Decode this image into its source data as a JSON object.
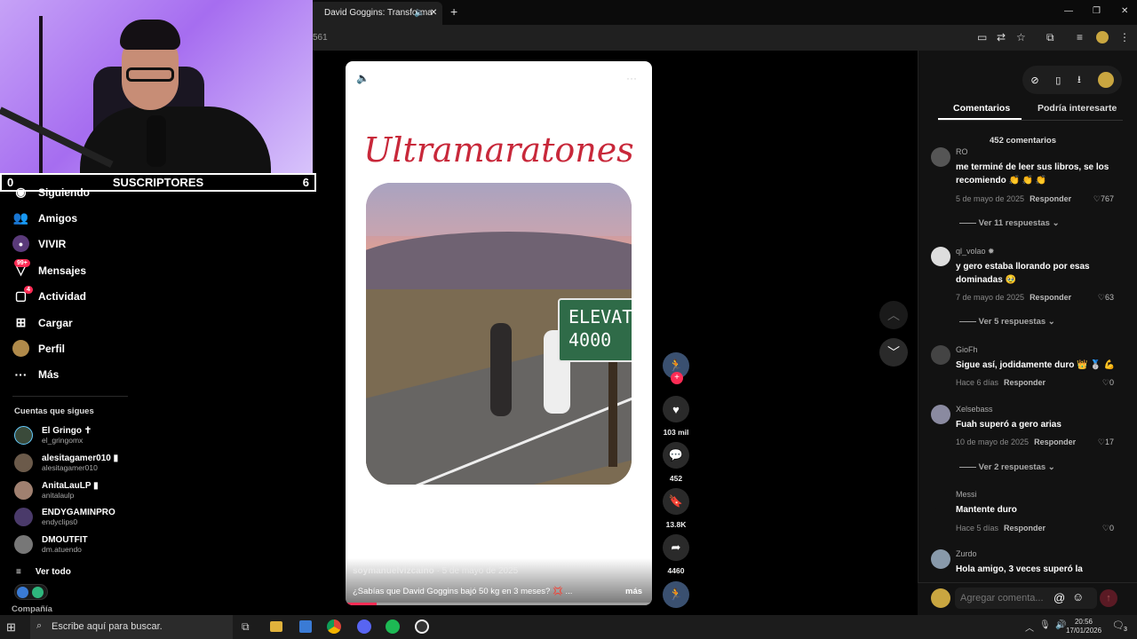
{
  "browser": {
    "tab_title": "David Goggins: Transforma",
    "url_fragment": "561",
    "new_tab": "+",
    "minimize": "—",
    "restore": "❐",
    "close": "✕"
  },
  "stream": {
    "subs_left": "0",
    "subs_label": "SUSCRIPTORES",
    "subs_right": "6"
  },
  "sidebar": {
    "items": [
      {
        "label": "Siguiendo",
        "icon": "following-icon"
      },
      {
        "label": "Amigos",
        "icon": "friends-icon"
      },
      {
        "label": "VIVIR",
        "icon": "live-icon"
      },
      {
        "label": "Mensajes",
        "icon": "messages-icon",
        "badge": "99+"
      },
      {
        "label": "Actividad",
        "icon": "activity-icon",
        "badge": "4"
      },
      {
        "label": "Cargar",
        "icon": "upload-icon"
      },
      {
        "label": "Perfil",
        "icon": "profile-icon"
      },
      {
        "label": "Más",
        "icon": "more-icon"
      }
    ],
    "following_title": "Cuentas que sigues",
    "following": [
      {
        "name": "El Gringo ✝",
        "handle": "el_gringomx"
      },
      {
        "name": "alesitagamer010 ▮",
        "handle": "alesitagamer010"
      },
      {
        "name": "AnitaLauLP ▮",
        "handle": "anitalaulp"
      },
      {
        "name": "ENDYGAMINPRO",
        "handle": "endyclips0"
      },
      {
        "name": "DMOUTFIT",
        "handle": "dm.atuendo"
      }
    ],
    "see_all": "Ver todo",
    "company": "Compañía"
  },
  "video": {
    "title": "Ultramaratones",
    "sign_line1": "ELEVAT",
    "sign_line2": "4000",
    "author": "soymanuelvizcaino",
    "date": "· 5 de mayo de 2025",
    "caption": "¿Sabías que David Goggins bajó 50 kg en 3 meses? 💢 ...",
    "more": "más",
    "progress": 0.1
  },
  "actions": {
    "likes": "103 mil",
    "comments": "452",
    "saves": "13.8K",
    "shares": "4460"
  },
  "comments_panel": {
    "tab_comments": "Comentarios",
    "tab_related": "Podría interesarte",
    "count": "452 comentarios",
    "reply_label": "Responder",
    "input_placeholder": "Agregar comenta...",
    "list": [
      {
        "user": "RO",
        "text": "me terminé de leer sus libros, se los recomiendo 👏 👏 👏",
        "date": "5 de mayo de 2025",
        "likes": "767",
        "replies": "Ver 11 respuestas"
      },
      {
        "user": "ql_volao ✹",
        "text": "y gero estaba llorando por esas dominadas 🥹",
        "date": "7 de mayo de 2025",
        "likes": "63",
        "replies": "Ver 5 respuestas"
      },
      {
        "user": "GioFh",
        "text": "Sigue así, jodidamente duro 👑 🥈 💪",
        "date": "Hace 6 días",
        "likes": "0",
        "replies": ""
      },
      {
        "user": "Xelsebass",
        "text": "Fuah superó a gero arias",
        "date": "10 de mayo de 2025",
        "likes": "17",
        "replies": "Ver 2 respuestas"
      },
      {
        "user": "Messi",
        "text": "Mantente duro",
        "date": "Hace 5 días",
        "likes": "0",
        "replies": ""
      },
      {
        "user": "Zurdo",
        "text": "Hola amigo, 3 veces superó la",
        "date": "",
        "likes": "",
        "replies": ""
      }
    ]
  },
  "taskbar": {
    "search": "Escribe aquí para buscar.",
    "time": "20:56",
    "date": "17/01/2026",
    "notif": "3"
  }
}
